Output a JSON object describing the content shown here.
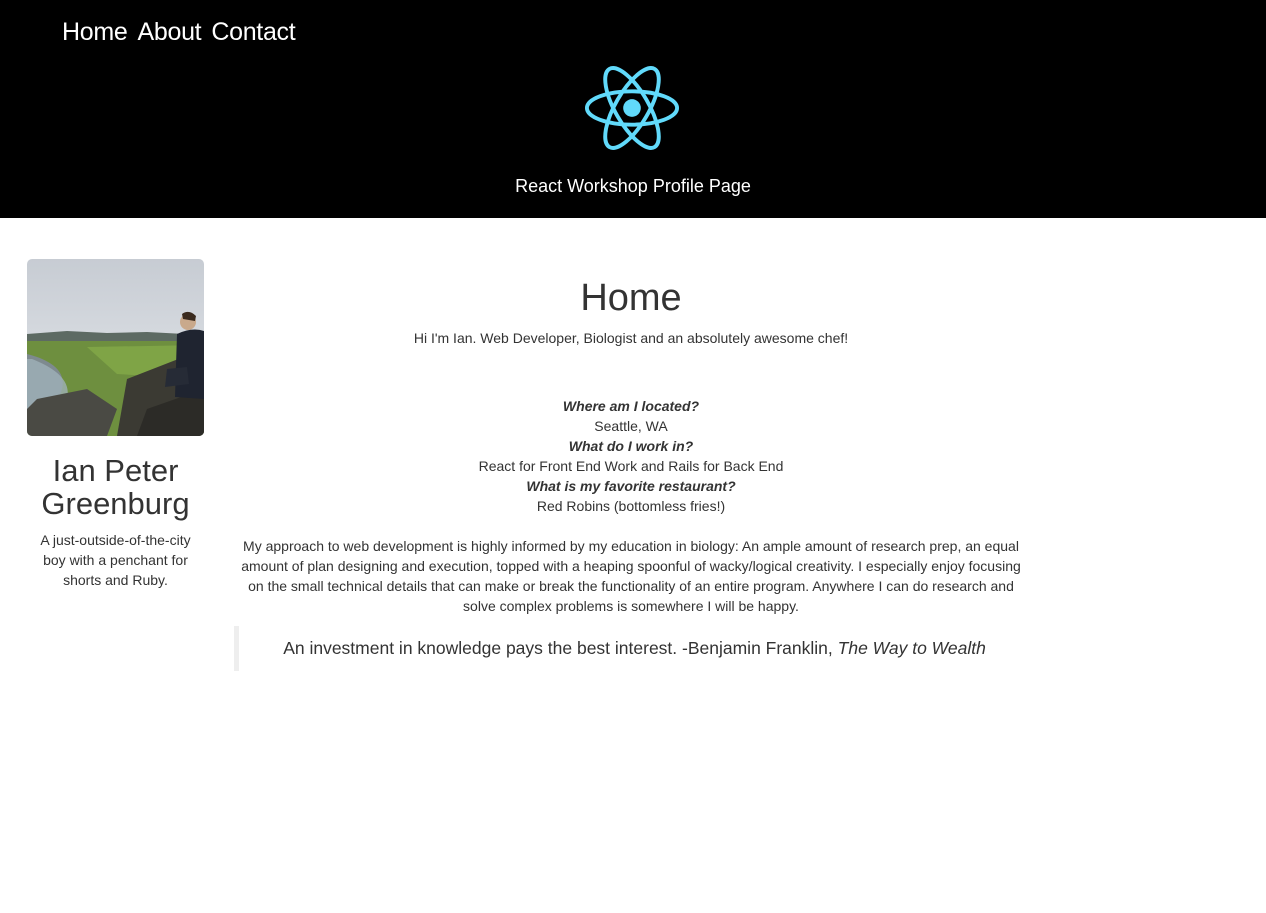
{
  "nav": {
    "items": [
      "Home",
      "About",
      "Contact"
    ]
  },
  "header": {
    "logo_icon": "react-atom-icon",
    "logo_color": "#61dafb",
    "title": "React Workshop Profile Page"
  },
  "sidebar": {
    "name": "Ian Peter Greenburg",
    "bio": "A just-outside-of-the-city boy with a penchant for shorts and Ruby."
  },
  "main": {
    "title": "Home",
    "intro": "Hi I'm Ian. Web Developer, Biologist and an absolutely awesome chef!",
    "qa": [
      {
        "question": "Where am I located?",
        "answer": "Seattle, WA"
      },
      {
        "question": "What do I work in?",
        "answer": "React for Front End Work and Rails for Back End"
      },
      {
        "question": "What is my favorite restaurant?",
        "answer": "Red Robins (bottomless fries!)"
      }
    ],
    "approach": "My approach to web development is highly informed by my education in biology: An ample amount of research prep, an equal amount of plan designing and execution, topped with a heaping spoonful of wacky/logical creativity. I especially enjoy focusing on the small technical details that can make or break the functionality of an entire program. Anywhere I can do research and solve complex problems is somewhere I will be happy.",
    "quote": {
      "text": "An investment in knowledge pays the best interest. -Benjamin Franklin, ",
      "source": "The Way to Wealth"
    }
  }
}
